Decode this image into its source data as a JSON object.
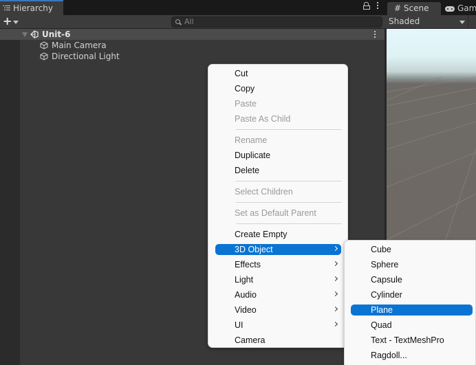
{
  "hierarchy": {
    "tab_label": "Hierarchy",
    "add_label": "+",
    "search_placeholder": "All",
    "scene_name": "Unit-6",
    "objects": [
      {
        "name": "Main Camera"
      },
      {
        "name": "Directional Light"
      }
    ]
  },
  "scene_view": {
    "tabs": [
      {
        "label": "Scene",
        "icon": "hash-icon"
      },
      {
        "label": "Game",
        "icon": "gamepad-icon"
      }
    ],
    "shading_mode": "Shaded"
  },
  "context_menu": {
    "items": [
      {
        "label": "Cut",
        "enabled": true
      },
      {
        "label": "Copy",
        "enabled": true
      },
      {
        "label": "Paste",
        "enabled": false
      },
      {
        "label": "Paste As Child",
        "enabled": false
      },
      {
        "label": "Rename",
        "enabled": false
      },
      {
        "label": "Duplicate",
        "enabled": true
      },
      {
        "label": "Delete",
        "enabled": true
      },
      {
        "label": "Select Children",
        "enabled": false
      },
      {
        "label": "Set as Default Parent",
        "enabled": false
      },
      {
        "label": "Create Empty",
        "enabled": true
      },
      {
        "label": "3D Object",
        "enabled": true,
        "submenu": true,
        "selected": true
      },
      {
        "label": "Effects",
        "enabled": true,
        "submenu": true
      },
      {
        "label": "Light",
        "enabled": true,
        "submenu": true
      },
      {
        "label": "Audio",
        "enabled": true,
        "submenu": true
      },
      {
        "label": "Video",
        "enabled": true,
        "submenu": true
      },
      {
        "label": "UI",
        "enabled": true,
        "submenu": true
      },
      {
        "label": "Camera",
        "enabled": true
      }
    ]
  },
  "submenu_3d_object": {
    "items": [
      {
        "label": "Cube"
      },
      {
        "label": "Sphere"
      },
      {
        "label": "Capsule"
      },
      {
        "label": "Cylinder"
      },
      {
        "label": "Plane",
        "selected": true
      },
      {
        "label": "Quad"
      },
      {
        "label": "Text - TextMeshPro"
      },
      {
        "label": "Ragdoll..."
      }
    ]
  },
  "colors": {
    "selection_blue": "#0a74d2",
    "tab_accent": "#3a79bb"
  }
}
